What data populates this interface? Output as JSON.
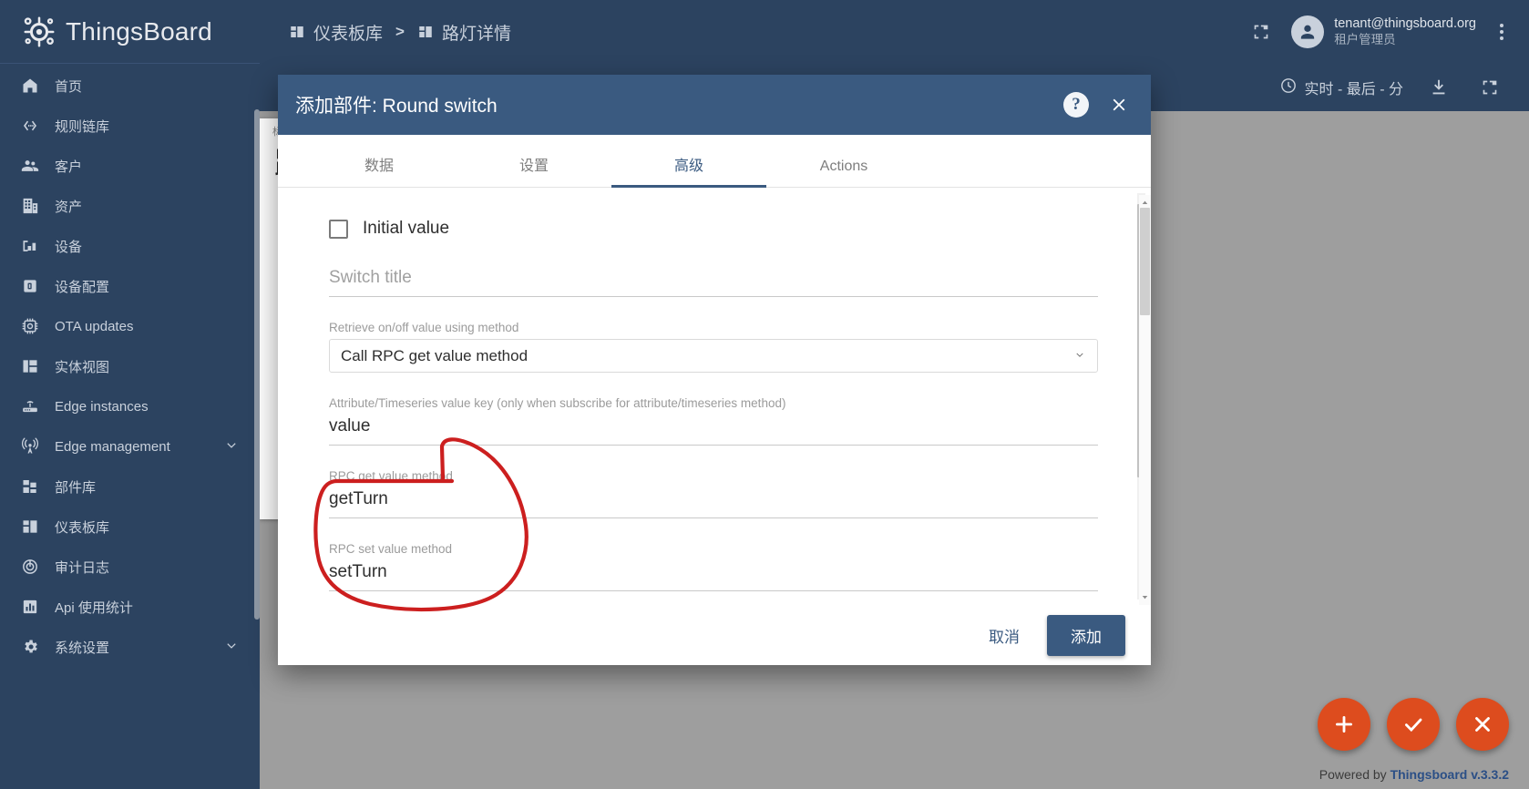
{
  "brand": {
    "name": "ThingsBoard",
    "logo_icon": "thingsboard-gear-logo"
  },
  "sidebar": {
    "items": [
      {
        "label": "首页",
        "icon": "home-icon",
        "expandable": false
      },
      {
        "label": "规则链库",
        "icon": "rule-chain-icon",
        "expandable": false
      },
      {
        "label": "客户",
        "icon": "customers-icon",
        "expandable": false
      },
      {
        "label": "资产",
        "icon": "assets-icon",
        "expandable": false
      },
      {
        "label": "设备",
        "icon": "devices-icon",
        "expandable": false
      },
      {
        "label": "设备配置",
        "icon": "device-profile-icon",
        "expandable": false
      },
      {
        "label": "OTA updates",
        "icon": "ota-chip-icon",
        "expandable": false
      },
      {
        "label": "实体视图",
        "icon": "entity-view-icon",
        "expandable": false
      },
      {
        "label": "Edge instances",
        "icon": "router-icon",
        "expandable": false
      },
      {
        "label": "Edge management",
        "icon": "edge-antenna-icon",
        "expandable": true
      },
      {
        "label": "部件库",
        "icon": "widget-library-icon",
        "expandable": false
      },
      {
        "label": "仪表板库",
        "icon": "dashboards-icon",
        "expandable": false
      },
      {
        "label": "审计日志",
        "icon": "audit-log-icon",
        "expandable": false
      },
      {
        "label": "Api 使用统计",
        "icon": "api-usage-icon",
        "expandable": false
      },
      {
        "label": "系统设置",
        "icon": "settings-gear-icon",
        "expandable": true
      }
    ]
  },
  "topbar": {
    "breadcrumb": [
      {
        "label": "仪表板库",
        "icon": "dashboards-icon"
      },
      {
        "label": "路灯详情",
        "icon": "dashboards-icon"
      }
    ],
    "separator": ">",
    "fullscreen_icon": "fullscreen-icon",
    "user": {
      "email": "tenant@thingsboard.org",
      "role": "租户管理员",
      "avatar_icon": "account-circle-icon"
    },
    "more_icon": "more-vertical-icon"
  },
  "dashboard_toolbar": {
    "timewindow_label": "实时 - 最后 - 分",
    "clock_icon": "clock-icon",
    "export_icon": "download-icon",
    "fullscreen_icon": "fullscreen-icon"
  },
  "dashboard_background": {
    "widget_title_label": "标题",
    "widget_big_title": "路"
  },
  "dialog": {
    "title": "添加部件: Round switch",
    "help_icon": "help-circle-icon",
    "close_icon": "close-icon",
    "tabs": [
      {
        "label": "数据",
        "active": false
      },
      {
        "label": "设置",
        "active": false
      },
      {
        "label": "高级",
        "active": true
      },
      {
        "label": "Actions",
        "active": false
      }
    ],
    "form": {
      "initial_value_checkbox_label": "Initial value",
      "initial_value_checked": false,
      "switch_title_placeholder": "Switch title",
      "switch_title_value": "",
      "retrieve_method_label": "Retrieve on/off value using method",
      "retrieve_method_value": "Call RPC get value method",
      "attribute_key_label": "Attribute/Timeseries value key (only when subscribe for attribute/timeseries method)",
      "attribute_key_value": "value",
      "rpc_get_label": "RPC get value method",
      "rpc_get_value": "getTurn",
      "rpc_set_label": "RPC set value method",
      "rpc_set_value": "setTurn"
    },
    "footer": {
      "cancel_label": "取消",
      "add_label": "添加"
    }
  },
  "fabs": [
    {
      "icon": "plus-icon",
      "name": "add-widget-fab"
    },
    {
      "icon": "check-icon",
      "name": "apply-changes-fab"
    },
    {
      "icon": "close-icon",
      "name": "discard-changes-fab"
    }
  ],
  "footer": {
    "powered_prefix": "Powered by ",
    "powered_product": "Thingsboard v.3.3.2"
  },
  "colors": {
    "sidebar_bg": "#2c4360",
    "dialog_header": "#3a5a80",
    "accent": "#3a5a80",
    "fab": "#dd4c1e",
    "annotation": "#cc1f1f"
  }
}
